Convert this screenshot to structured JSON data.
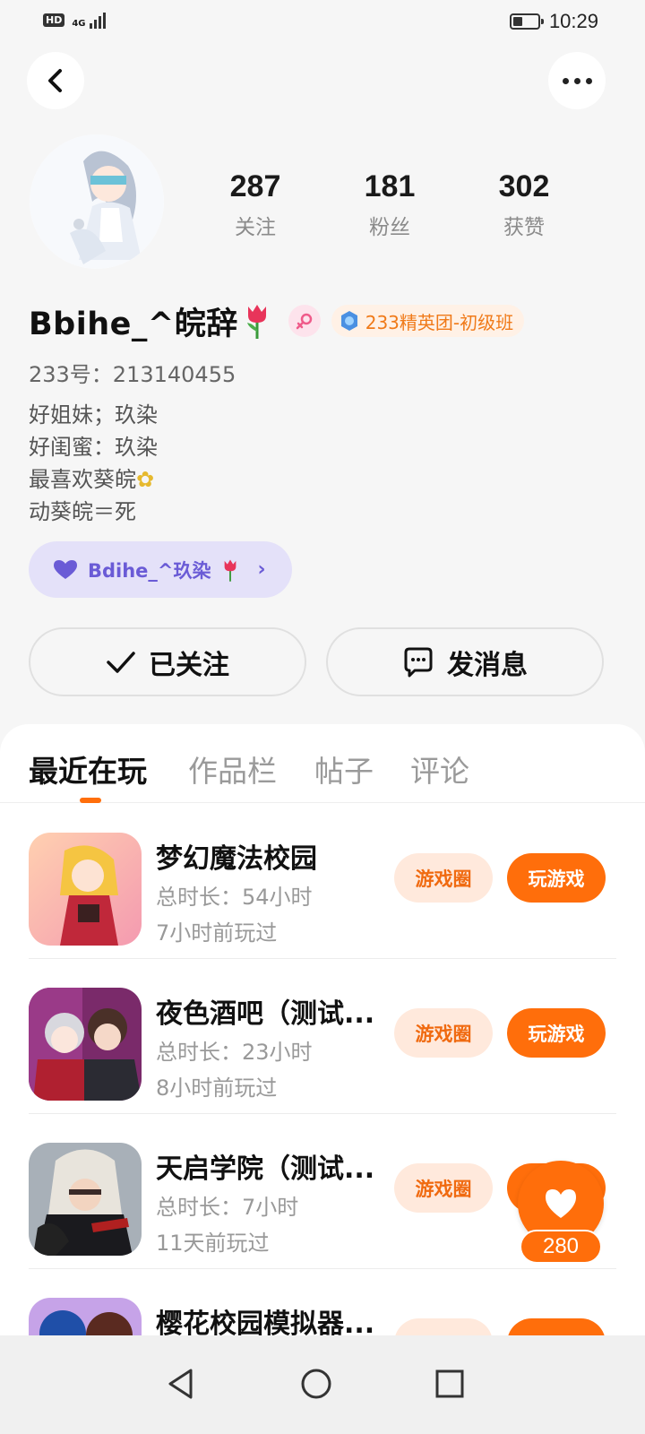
{
  "status_bar": {
    "hd": "HD",
    "network": "4G",
    "battery_percent": 40,
    "time": "10:29"
  },
  "nav": {
    "back_icon": "back-arrow-icon",
    "more_icon": "more-dots-icon"
  },
  "profile": {
    "stats": [
      {
        "value": "287",
        "label": "关注"
      },
      {
        "value": "181",
        "label": "粉丝"
      },
      {
        "value": "302",
        "label": "获赞"
      }
    ],
    "username": "Bbihe_^皖辞",
    "rank_badge": "233精英团-初级班",
    "uid": "233号：213140455",
    "bio": [
      "好姐妹；玖染",
      "好闺蜜：玖染",
      "最喜欢葵皖",
      "动葵皖＝死"
    ],
    "relation_chip": "Bdihe_^玖染",
    "follow_button": "已关注",
    "message_button": "发消息"
  },
  "tabs": [
    "最近在玩",
    "作品栏",
    "帖子",
    "评论"
  ],
  "active_tab": "最近在玩",
  "games": [
    {
      "title": "梦幻魔法校园",
      "duration": "总时长：54小时",
      "last_played": "7小时前玩过",
      "circle": "游戏圈",
      "play": "玩游戏"
    },
    {
      "title": "夜色酒吧（测试...",
      "duration": "总时长：23小时",
      "last_played": "8小时前玩过",
      "circle": "游戏圈",
      "play": "玩游戏"
    },
    {
      "title": "天启学院（测试...",
      "duration": "总时长：7小时",
      "last_played": "11天前玩过",
      "circle": "游戏圈",
      "play": "玩游戏"
    },
    {
      "title": "樱花校园模拟器...",
      "duration": "",
      "last_played": "",
      "circle": "",
      "play": ""
    }
  ],
  "like_fab": {
    "count": "280"
  },
  "colors": {
    "accent": "#ff6e0b",
    "accent_light": "#ffe9dc",
    "relation_bg": "#e4e1f9",
    "relation_text": "#6a5bd6"
  }
}
